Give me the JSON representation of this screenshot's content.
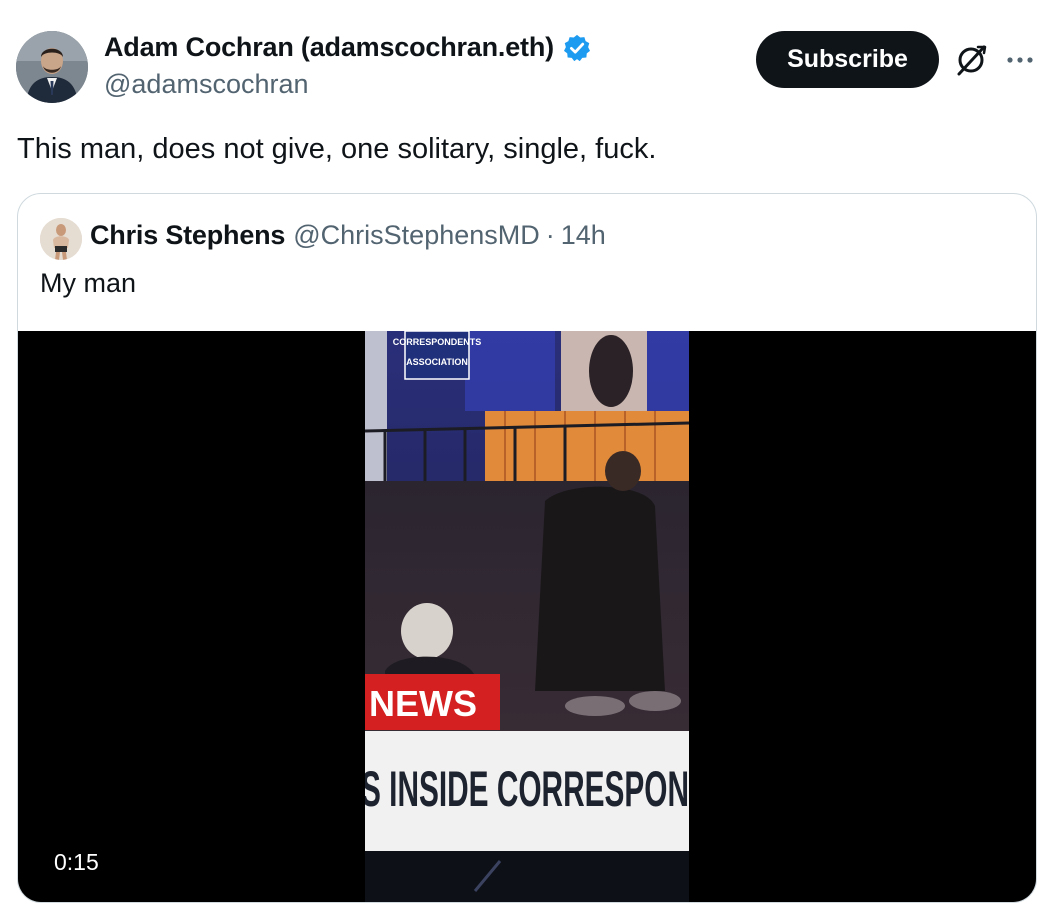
{
  "author": {
    "display_name": "Adam Cochran (adamscochran.eth)",
    "handle": "@adamscochran",
    "avatar_icon": "user-avatar",
    "verified_icon": "verified-badge-icon",
    "verified_color": "#1d9bf0"
  },
  "actions": {
    "subscribe_label": "Subscribe",
    "grok_icon": "grok-icon",
    "more_icon": "more-icon"
  },
  "tweet": {
    "text": "This man, does not give, one solitary, single, fuck."
  },
  "quoted": {
    "display_name": "Chris Stephens",
    "handle": "@ChrisStephensMD",
    "separator": "·",
    "time": "14h",
    "text": "My man",
    "avatar_icon": "user-avatar"
  },
  "video": {
    "duration": "0:15",
    "frame_text": {
      "sign": "CORRESPONDENTS ASSOCIATION",
      "tag": "NEWS",
      "chyron": "S INSIDE CORRESPON"
    }
  },
  "colors": {
    "text_primary": "#0f1419",
    "text_secondary": "#536471",
    "border": "#cfd9de",
    "button_bg": "#0f1419"
  }
}
